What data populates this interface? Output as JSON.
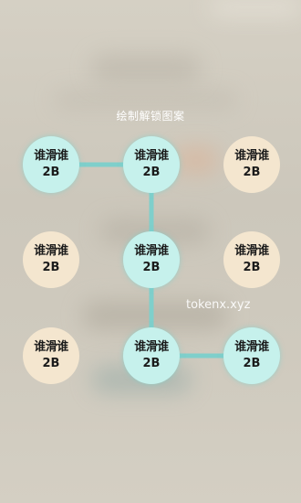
{
  "title": "绘制解锁图案",
  "node_text": {
    "line1": "谁滑谁",
    "line2": "2B"
  },
  "grid": [
    {
      "name": "node-1-1",
      "active": true
    },
    {
      "name": "node-1-2",
      "active": true
    },
    {
      "name": "node-1-3",
      "active": false
    },
    {
      "name": "node-2-1",
      "active": false
    },
    {
      "name": "node-2-2",
      "active": true
    },
    {
      "name": "node-2-3",
      "active": false
    },
    {
      "name": "node-3-1",
      "active": false
    },
    {
      "name": "node-3-2",
      "active": true
    },
    {
      "name": "node-3-3",
      "active": true
    }
  ],
  "pattern_path": [
    1,
    2,
    5,
    8,
    9
  ],
  "colors": {
    "active_fill": "#c6f1ec",
    "inactive_fill": "#f4e6cf",
    "line": "#7fcfcb"
  },
  "watermark": "tokenx.xyz"
}
